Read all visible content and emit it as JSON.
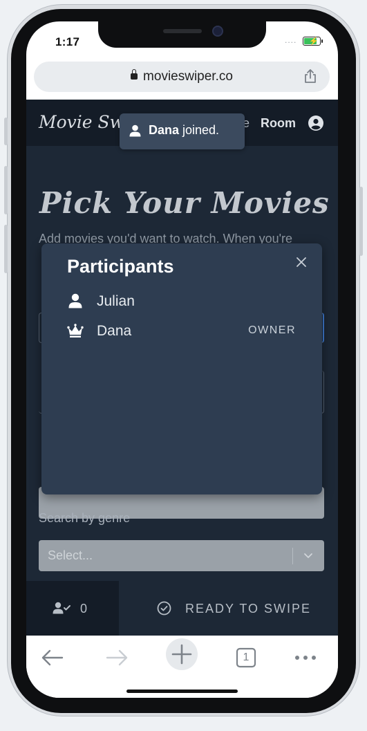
{
  "status_bar": {
    "time": "1:17",
    "signal": "...."
  },
  "browser": {
    "url": "movieswiper.co",
    "tab_count": "1"
  },
  "navbar": {
    "brand": "Movie Swi",
    "partial_item": "e",
    "room_label": "Room"
  },
  "toast": {
    "name": "Dana",
    "message": " joined."
  },
  "page": {
    "title": "Pick Your Movies",
    "intro": "Add movies you'd want to watch. When you're",
    "genre_label": "Search by genre",
    "genre_placeholder": "Select..."
  },
  "bottom_bar": {
    "ready_count": "0",
    "ready_button": "READY TO SWIPE"
  },
  "participants_modal": {
    "title": "Participants",
    "participants": [
      {
        "name": "Julian",
        "role": "",
        "icon": "user-icon"
      },
      {
        "name": "Dana",
        "role": "OWNER",
        "icon": "crown-icon"
      }
    ]
  },
  "colors": {
    "app_bg": "#1d2836",
    "navbar_bg": "#141c27",
    "modal_bg": "#2e3d51",
    "toast_bg": "#3b4a5e"
  }
}
